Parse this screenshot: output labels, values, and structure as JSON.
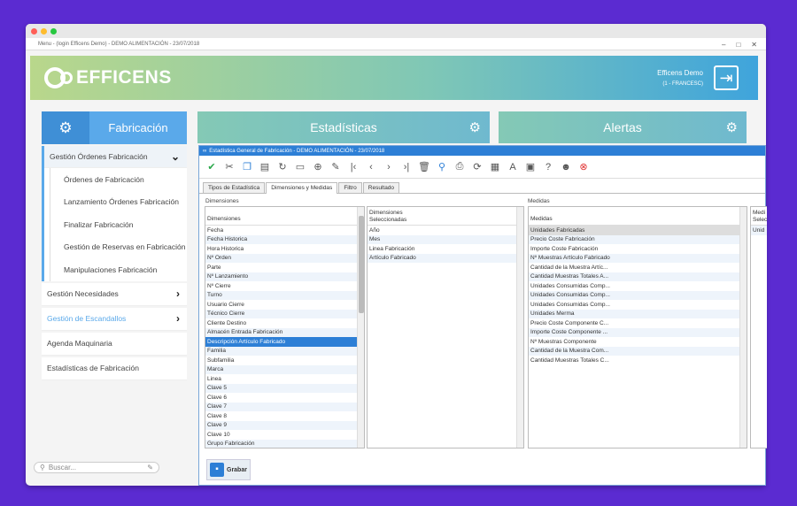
{
  "window": {
    "title": "Menu - (login Efficens Demo) - DEMO ALIMENTACIÓN - 23/07/2018",
    "controls": [
      "–",
      "□",
      "✕"
    ]
  },
  "header": {
    "brand": "EFFICENS",
    "user_name": "Efficens Demo",
    "user_sub": "(1 - FRANCESC)"
  },
  "sidebar": {
    "title": "Fabricación",
    "open_section": "Gestión Órdenes Fabricación",
    "sub_items": [
      "Órdenes de Fabricación",
      "Lanzamiento Órdenes Fabricación",
      "Finalizar Fabricación",
      "Gestión de Reservas en Fabricación",
      "Manipulaciones Fabricación"
    ],
    "other_items": [
      "Gestión Necesidades",
      "Gestión de Escandallos",
      "Agenda Maquinaria",
      "Estadísticas de Fabricación"
    ],
    "search_placeholder": "Buscar..."
  },
  "panels": {
    "estadisticas": "Estadísticas",
    "alertas": "Alertas"
  },
  "dialog": {
    "title": "Estadística General de Fabricación - DEMO ALIMENTACIÓN - 23/07/2018",
    "tabs": [
      "Tipos de Estadística",
      "Dimensiones y Medidas",
      "Filtro",
      "Resultado"
    ],
    "active_tab": "Dimensiones y Medidas",
    "label_dimensiones": "Dimensiones",
    "label_medidas": "Medidas",
    "dimensiones_header": "Dimensiones",
    "dimensiones": [
      "Fecha",
      "Fecha Historica",
      "Hora Historica",
      "Nº Orden",
      "Parte",
      "Nº Lanzamiento",
      "Nº Cierre",
      "Turno",
      "Usuario Cierre",
      "Técnico Cierre",
      "Cliente Destino",
      "Almacén Entrada Fabricación",
      "Descripción Artículo Fabricado",
      "Familia",
      "Subfamilia",
      "Marca",
      "Linea",
      "Clave 5",
      "Clave 6",
      "Clave 7",
      "Clave 8",
      "Clave 9",
      "Clave 10",
      "Grupo Fabricación"
    ],
    "dimensiones_selected": "Descripción Artículo Fabricado",
    "dim_sel_header_1": "Dimensiones",
    "dim_sel_header_2": "Seleccionadas",
    "dimensiones_seleccionadas": [
      "Año",
      "Mes",
      "Linea Fabricación",
      "Artículo Fabricado"
    ],
    "medidas_header": "Medidas",
    "medidas": [
      "Unidades Fabricadas",
      "Precio Coste Fabricación",
      "Importe Coste Fabricación",
      "Nº Muestras Artículo Fabricado",
      "Cantidad de la Muestra Artíc...",
      "Cantidad Muestras Totales A...",
      "Unidades Consumidas Comp...",
      "Unidades Consumidas Comp...",
      "Unidades Consumidas Comp...",
      "Unidades Merma",
      "Precio Coste Componente C...",
      "Importe Coste Componente ...",
      "Nº Muestras Componente",
      "Cantidad de la Muestra Com...",
      "Cantidad Muestras Totales C..."
    ],
    "medidas_sel_header": "Medi Selec",
    "medidas_sel_first": "Unid",
    "save_label": "Grabar"
  }
}
